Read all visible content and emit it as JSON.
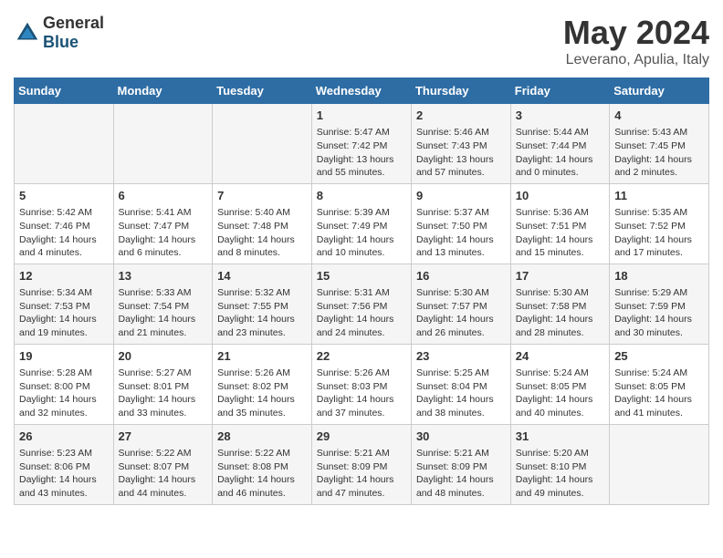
{
  "header": {
    "logo_general": "General",
    "logo_blue": "Blue",
    "main_title": "May 2024",
    "subtitle": "Leverano, Apulia, Italy"
  },
  "days_of_week": [
    "Sunday",
    "Monday",
    "Tuesday",
    "Wednesday",
    "Thursday",
    "Friday",
    "Saturday"
  ],
  "weeks": [
    [
      {
        "day": "",
        "info": ""
      },
      {
        "day": "",
        "info": ""
      },
      {
        "day": "",
        "info": ""
      },
      {
        "day": "1",
        "info": "Sunrise: 5:47 AM\nSunset: 7:42 PM\nDaylight: 13 hours\nand 55 minutes."
      },
      {
        "day": "2",
        "info": "Sunrise: 5:46 AM\nSunset: 7:43 PM\nDaylight: 13 hours\nand 57 minutes."
      },
      {
        "day": "3",
        "info": "Sunrise: 5:44 AM\nSunset: 7:44 PM\nDaylight: 14 hours\nand 0 minutes."
      },
      {
        "day": "4",
        "info": "Sunrise: 5:43 AM\nSunset: 7:45 PM\nDaylight: 14 hours\nand 2 minutes."
      }
    ],
    [
      {
        "day": "5",
        "info": "Sunrise: 5:42 AM\nSunset: 7:46 PM\nDaylight: 14 hours\nand 4 minutes."
      },
      {
        "day": "6",
        "info": "Sunrise: 5:41 AM\nSunset: 7:47 PM\nDaylight: 14 hours\nand 6 minutes."
      },
      {
        "day": "7",
        "info": "Sunrise: 5:40 AM\nSunset: 7:48 PM\nDaylight: 14 hours\nand 8 minutes."
      },
      {
        "day": "8",
        "info": "Sunrise: 5:39 AM\nSunset: 7:49 PM\nDaylight: 14 hours\nand 10 minutes."
      },
      {
        "day": "9",
        "info": "Sunrise: 5:37 AM\nSunset: 7:50 PM\nDaylight: 14 hours\nand 13 minutes."
      },
      {
        "day": "10",
        "info": "Sunrise: 5:36 AM\nSunset: 7:51 PM\nDaylight: 14 hours\nand 15 minutes."
      },
      {
        "day": "11",
        "info": "Sunrise: 5:35 AM\nSunset: 7:52 PM\nDaylight: 14 hours\nand 17 minutes."
      }
    ],
    [
      {
        "day": "12",
        "info": "Sunrise: 5:34 AM\nSunset: 7:53 PM\nDaylight: 14 hours\nand 19 minutes."
      },
      {
        "day": "13",
        "info": "Sunrise: 5:33 AM\nSunset: 7:54 PM\nDaylight: 14 hours\nand 21 minutes."
      },
      {
        "day": "14",
        "info": "Sunrise: 5:32 AM\nSunset: 7:55 PM\nDaylight: 14 hours\nand 23 minutes."
      },
      {
        "day": "15",
        "info": "Sunrise: 5:31 AM\nSunset: 7:56 PM\nDaylight: 14 hours\nand 24 minutes."
      },
      {
        "day": "16",
        "info": "Sunrise: 5:30 AM\nSunset: 7:57 PM\nDaylight: 14 hours\nand 26 minutes."
      },
      {
        "day": "17",
        "info": "Sunrise: 5:30 AM\nSunset: 7:58 PM\nDaylight: 14 hours\nand 28 minutes."
      },
      {
        "day": "18",
        "info": "Sunrise: 5:29 AM\nSunset: 7:59 PM\nDaylight: 14 hours\nand 30 minutes."
      }
    ],
    [
      {
        "day": "19",
        "info": "Sunrise: 5:28 AM\nSunset: 8:00 PM\nDaylight: 14 hours\nand 32 minutes."
      },
      {
        "day": "20",
        "info": "Sunrise: 5:27 AM\nSunset: 8:01 PM\nDaylight: 14 hours\nand 33 minutes."
      },
      {
        "day": "21",
        "info": "Sunrise: 5:26 AM\nSunset: 8:02 PM\nDaylight: 14 hours\nand 35 minutes."
      },
      {
        "day": "22",
        "info": "Sunrise: 5:26 AM\nSunset: 8:03 PM\nDaylight: 14 hours\nand 37 minutes."
      },
      {
        "day": "23",
        "info": "Sunrise: 5:25 AM\nSunset: 8:04 PM\nDaylight: 14 hours\nand 38 minutes."
      },
      {
        "day": "24",
        "info": "Sunrise: 5:24 AM\nSunset: 8:05 PM\nDaylight: 14 hours\nand 40 minutes."
      },
      {
        "day": "25",
        "info": "Sunrise: 5:24 AM\nSunset: 8:05 PM\nDaylight: 14 hours\nand 41 minutes."
      }
    ],
    [
      {
        "day": "26",
        "info": "Sunrise: 5:23 AM\nSunset: 8:06 PM\nDaylight: 14 hours\nand 43 minutes."
      },
      {
        "day": "27",
        "info": "Sunrise: 5:22 AM\nSunset: 8:07 PM\nDaylight: 14 hours\nand 44 minutes."
      },
      {
        "day": "28",
        "info": "Sunrise: 5:22 AM\nSunset: 8:08 PM\nDaylight: 14 hours\nand 46 minutes."
      },
      {
        "day": "29",
        "info": "Sunrise: 5:21 AM\nSunset: 8:09 PM\nDaylight: 14 hours\nand 47 minutes."
      },
      {
        "day": "30",
        "info": "Sunrise: 5:21 AM\nSunset: 8:09 PM\nDaylight: 14 hours\nand 48 minutes."
      },
      {
        "day": "31",
        "info": "Sunrise: 5:20 AM\nSunset: 8:10 PM\nDaylight: 14 hours\nand 49 minutes."
      },
      {
        "day": "",
        "info": ""
      }
    ]
  ]
}
